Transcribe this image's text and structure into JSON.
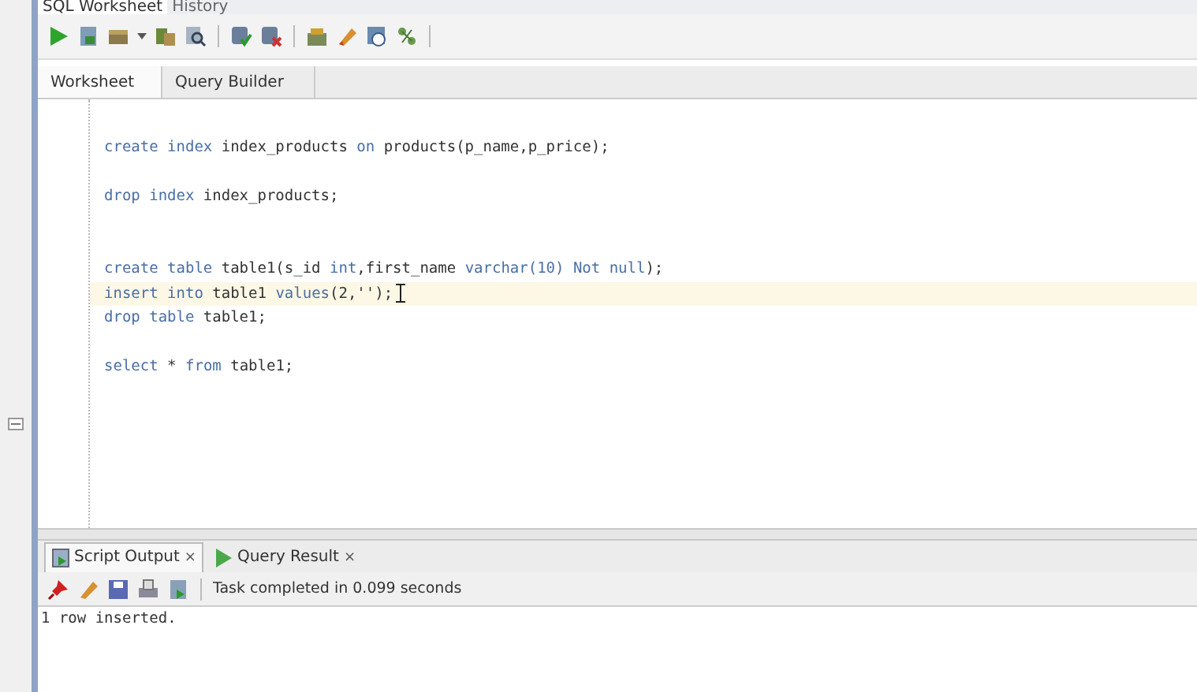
{
  "top_tabs": [
    {
      "label": "SQL Worksheet",
      "selected": true
    },
    {
      "label": "History",
      "selected": false
    }
  ],
  "editor_tabs": [
    {
      "label": "Worksheet",
      "selected": true
    },
    {
      "label": "Query Builder",
      "selected": false
    }
  ],
  "code_lines": [
    {
      "kind": "blank"
    },
    {
      "kind": "code",
      "current": false,
      "segments": [
        {
          "text": "create index ",
          "kind": "keyword"
        },
        {
          "text": "index_products ",
          "kind": "plain"
        },
        {
          "text": "on ",
          "kind": "keyword"
        },
        {
          "text": "products(p_name,p_price);",
          "kind": "plain"
        }
      ]
    },
    {
      "kind": "blank"
    },
    {
      "kind": "code",
      "current": false,
      "segments": [
        {
          "text": "drop index ",
          "kind": "keyword"
        },
        {
          "text": "index_products;",
          "kind": "plain"
        }
      ]
    },
    {
      "kind": "blank"
    },
    {
      "kind": "blank"
    },
    {
      "kind": "code",
      "current": false,
      "segments": [
        {
          "text": "create table ",
          "kind": "keyword"
        },
        {
          "text": "table1(s_id ",
          "kind": "plain"
        },
        {
          "text": "int",
          "kind": "keyword"
        },
        {
          "text": ",first_name ",
          "kind": "plain"
        },
        {
          "text": "varchar(10) Not null",
          "kind": "keyword"
        },
        {
          "text": ");",
          "kind": "plain"
        }
      ]
    },
    {
      "kind": "code",
      "current": true,
      "segments": [
        {
          "text": "insert into ",
          "kind": "keyword"
        },
        {
          "text": "table1 ",
          "kind": "plain"
        },
        {
          "text": "values",
          "kind": "keyword"
        },
        {
          "text": "(2,'');",
          "kind": "plain"
        }
      ]
    },
    {
      "kind": "code",
      "current": false,
      "segments": [
        {
          "text": "drop table ",
          "kind": "keyword"
        },
        {
          "text": "table1;",
          "kind": "plain"
        }
      ]
    },
    {
      "kind": "blank"
    },
    {
      "kind": "code",
      "current": false,
      "segments": [
        {
          "text": "select ",
          "kind": "keyword"
        },
        {
          "text": "*",
          "kind": "plain"
        },
        {
          "text": " from ",
          "kind": "keyword"
        },
        {
          "text": "table1;",
          "kind": "plain"
        }
      ]
    }
  ],
  "output_tabs": [
    {
      "label": "Script Output",
      "close": "×",
      "selected": true,
      "kind": "script"
    },
    {
      "label": "Query Result",
      "close": "×",
      "selected": false,
      "kind": "query"
    }
  ],
  "output_status": "Task completed in 0.099 seconds",
  "output_text": "1 row inserted."
}
